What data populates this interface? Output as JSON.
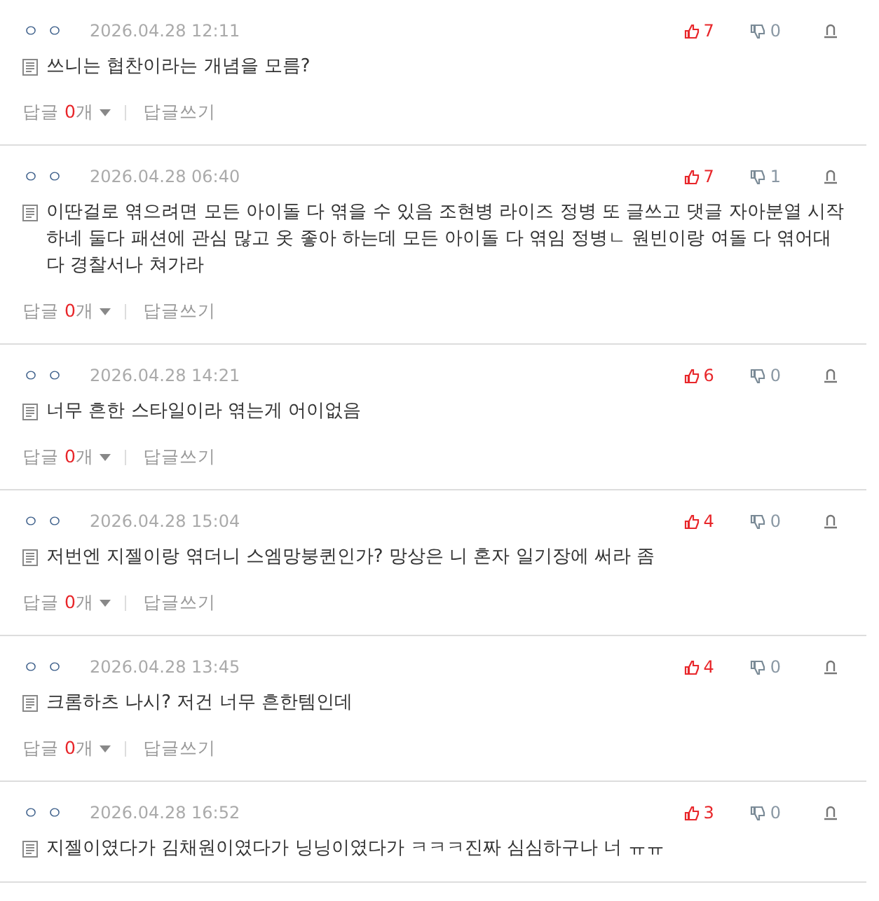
{
  "comments": [
    {
      "nickname": "ㅇㅇ",
      "date": "2026.04.28 12:11",
      "likes": "7",
      "dislikes": "0",
      "text": "쓰니는 협찬이라는 개념을 모름?",
      "reply": {
        "label": "답글",
        "count": "0",
        "unit": "개",
        "write": "답글쓰기"
      }
    },
    {
      "nickname": "ㅇㅇ",
      "date": "2026.04.28 06:40",
      "likes": "7",
      "dislikes": "1",
      "text": "이딴걸로 엮으려면 모든 아이돌 다 엮을 수 있음 조현병 라이즈 정병 또 글쓰고 댓글 자아분열 시작하네 둘다 패션에 관심 많고 옷 좋아 하는데 모든 아이돌 다 엮임 정병ㄴ 원빈이랑 여돌 다 엮어대다 경찰서나 쳐가라",
      "reply": {
        "label": "답글",
        "count": "0",
        "unit": "개",
        "write": "답글쓰기"
      }
    },
    {
      "nickname": "ㅇㅇ",
      "date": "2026.04.28 14:21",
      "likes": "6",
      "dislikes": "0",
      "text": "너무 흔한 스타일이라 엮는게 어이없음",
      "reply": {
        "label": "답글",
        "count": "0",
        "unit": "개",
        "write": "답글쓰기"
      }
    },
    {
      "nickname": "ㅇㅇ",
      "date": "2026.04.28 15:04",
      "likes": "4",
      "dislikes": "0",
      "text": "저번엔 지젤이랑 엮더니 스엠망붕퀸인가? 망상은 니 혼자 일기장에 써라 좀",
      "reply": {
        "label": "답글",
        "count": "0",
        "unit": "개",
        "write": "답글쓰기"
      }
    },
    {
      "nickname": "ㅇㅇ",
      "date": "2026.04.28 13:45",
      "likes": "4",
      "dislikes": "0",
      "text": "크롬하츠 나시? 저건 너무 흔한템인데",
      "reply": {
        "label": "답글",
        "count": "0",
        "unit": "개",
        "write": "답글쓰기"
      }
    },
    {
      "nickname": "ㅇㅇ",
      "date": "2026.04.28 16:52",
      "likes": "3",
      "dislikes": "0",
      "text": "지젤이였다가 김채원이였다가 닝닝이였다가 ㅋㅋㅋ진짜 심심하구나 너 ㅠㅠ"
    }
  ]
}
